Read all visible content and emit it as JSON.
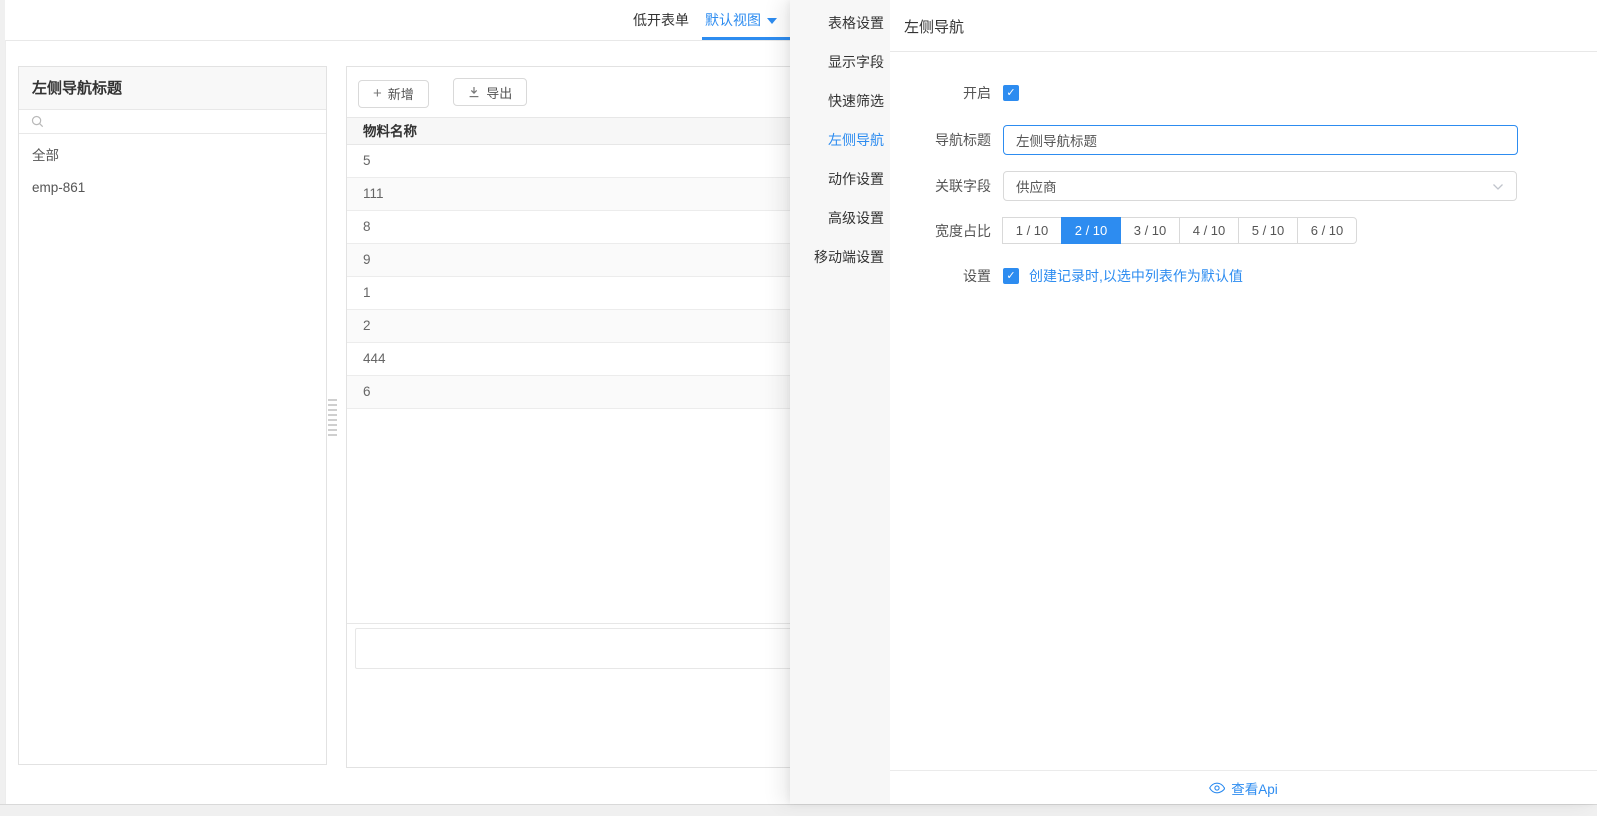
{
  "colors": {
    "accent": "#2d8cf0"
  },
  "topbar": {
    "tabs": [
      {
        "label": "低开表单"
      },
      {
        "label": "默认视图"
      }
    ]
  },
  "left_panel": {
    "title": "左侧导航标题",
    "search_placeholder": "",
    "items": [
      {
        "label": "全部"
      },
      {
        "label": "emp-861"
      }
    ]
  },
  "toolbar": {
    "add_label": "新增",
    "export_label": "导出"
  },
  "table": {
    "columns": [
      "物料名称"
    ],
    "rows": [
      {
        "label": "5"
      },
      {
        "label": "111"
      },
      {
        "label": "8"
      },
      {
        "label": "9"
      },
      {
        "label": "1"
      },
      {
        "label": "2"
      },
      {
        "label": "444"
      },
      {
        "label": "6"
      }
    ]
  },
  "drawer": {
    "nav_items": [
      {
        "label": "表格设置"
      },
      {
        "label": "显示字段"
      },
      {
        "label": "快速筛选"
      },
      {
        "label": "左侧导航",
        "active": true
      },
      {
        "label": "动作设置"
      },
      {
        "label": "高级设置"
      },
      {
        "label": "移动端设置"
      }
    ],
    "title": "左侧导航",
    "form": {
      "enable_label": "开启",
      "enable_checked": "✓",
      "nav_title_label": "导航标题",
      "nav_title_value": "左侧导航标题",
      "field_label": "关联字段",
      "field_value": "供应商",
      "width_label": "宽度占比",
      "width_options": [
        {
          "label": "1 / 10"
        },
        {
          "label": "2 / 10",
          "selected": true
        },
        {
          "label": "3 / 10"
        },
        {
          "label": "4 / 10"
        },
        {
          "label": "5 / 10"
        },
        {
          "label": "6 / 10"
        }
      ],
      "settings_label": "设置",
      "settings_checked": "✓",
      "settings_option": "创建记录时,以选中列表作为默认值"
    },
    "footer": {
      "api_link": "查看Api"
    }
  }
}
